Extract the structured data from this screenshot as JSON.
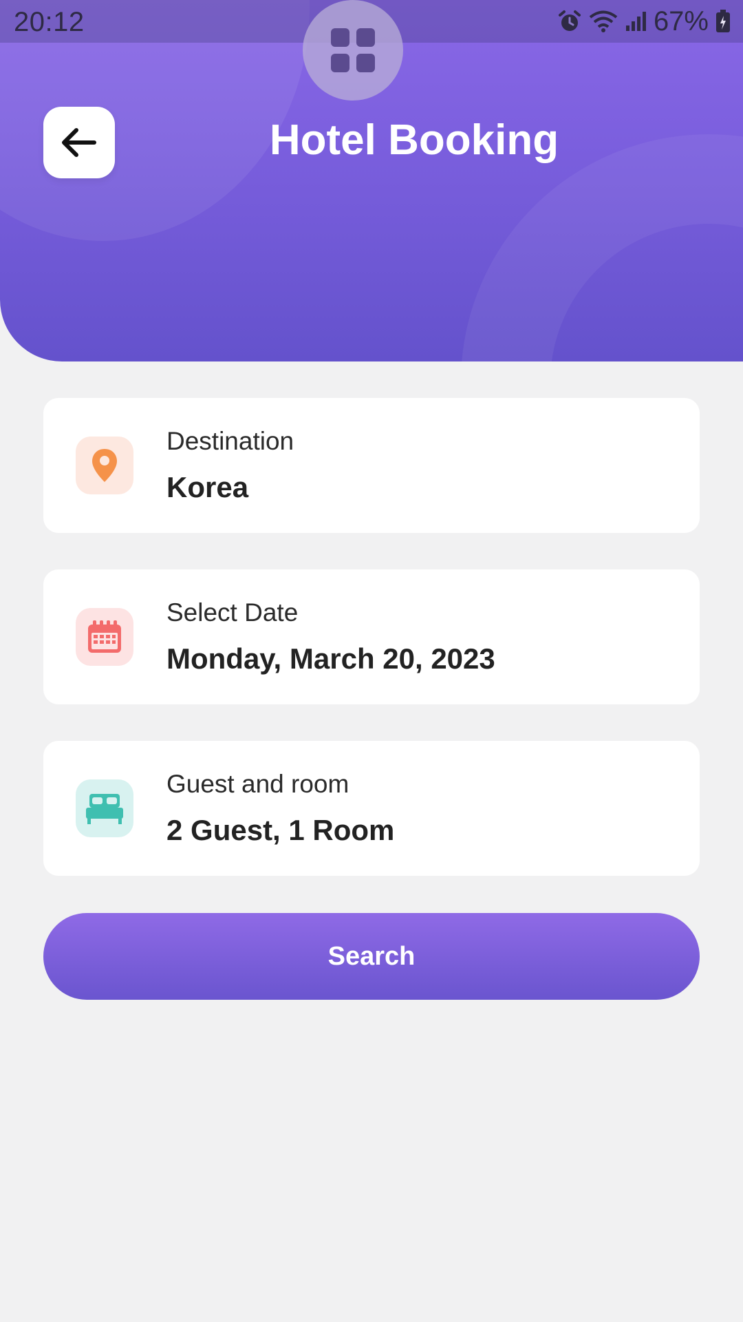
{
  "status_bar": {
    "time": "20:12",
    "battery_percent": "67%",
    "icons": [
      "alarm-icon",
      "wifi-icon",
      "signal-icon",
      "battery-icon"
    ]
  },
  "header": {
    "title": "Hotel Booking",
    "back_icon": "arrow-left-icon",
    "gradient_top": "#8a68e6",
    "gradient_bottom": "#6452cc"
  },
  "form": {
    "destination": {
      "label": "Destination",
      "value": "Korea",
      "icon": "location-pin-icon",
      "icon_bg": "#fde8e0",
      "icon_color": "#f5924a"
    },
    "date": {
      "label": "Select Date",
      "value": "Monday, March 20, 2023",
      "icon": "calendar-icon",
      "icon_bg": "#fde3e3",
      "icon_color": "#f36b6b"
    },
    "guests": {
      "label": "Guest and room",
      "value": "2 Guest, 1 Room",
      "icon": "bed-icon",
      "icon_bg": "#d8f2f0",
      "icon_color": "#3fbfb0"
    }
  },
  "search_button": {
    "label": "Search"
  }
}
